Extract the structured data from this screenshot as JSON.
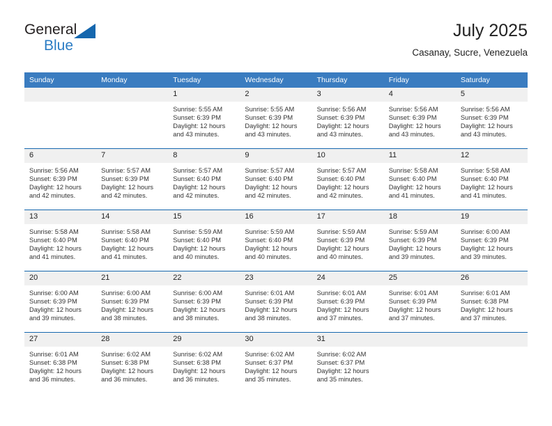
{
  "brand": {
    "name_part1": "General",
    "name_part2": "Blue"
  },
  "header": {
    "title": "July 2025",
    "subtitle": "Casanay, Sucre, Venezuela"
  },
  "colors": {
    "header_blue": "#3a7cc0",
    "rule_blue": "#1567ae",
    "daynum_band": "#f0f0f0",
    "logo_blue": "#2b7cc4"
  },
  "weekdays": [
    "Sunday",
    "Monday",
    "Tuesday",
    "Wednesday",
    "Thursday",
    "Friday",
    "Saturday"
  ],
  "weeks": [
    [
      {
        "day": "",
        "lines": []
      },
      {
        "day": "",
        "lines": []
      },
      {
        "day": "1",
        "lines": [
          "Sunrise: 5:55 AM",
          "Sunset: 6:39 PM",
          "Daylight: 12 hours",
          "and 43 minutes."
        ]
      },
      {
        "day": "2",
        "lines": [
          "Sunrise: 5:55 AM",
          "Sunset: 6:39 PM",
          "Daylight: 12 hours",
          "and 43 minutes."
        ]
      },
      {
        "day": "3",
        "lines": [
          "Sunrise: 5:56 AM",
          "Sunset: 6:39 PM",
          "Daylight: 12 hours",
          "and 43 minutes."
        ]
      },
      {
        "day": "4",
        "lines": [
          "Sunrise: 5:56 AM",
          "Sunset: 6:39 PM",
          "Daylight: 12 hours",
          "and 43 minutes."
        ]
      },
      {
        "day": "5",
        "lines": [
          "Sunrise: 5:56 AM",
          "Sunset: 6:39 PM",
          "Daylight: 12 hours",
          "and 43 minutes."
        ]
      }
    ],
    [
      {
        "day": "6",
        "lines": [
          "Sunrise: 5:56 AM",
          "Sunset: 6:39 PM",
          "Daylight: 12 hours",
          "and 42 minutes."
        ]
      },
      {
        "day": "7",
        "lines": [
          "Sunrise: 5:57 AM",
          "Sunset: 6:39 PM",
          "Daylight: 12 hours",
          "and 42 minutes."
        ]
      },
      {
        "day": "8",
        "lines": [
          "Sunrise: 5:57 AM",
          "Sunset: 6:40 PM",
          "Daylight: 12 hours",
          "and 42 minutes."
        ]
      },
      {
        "day": "9",
        "lines": [
          "Sunrise: 5:57 AM",
          "Sunset: 6:40 PM",
          "Daylight: 12 hours",
          "and 42 minutes."
        ]
      },
      {
        "day": "10",
        "lines": [
          "Sunrise: 5:57 AM",
          "Sunset: 6:40 PM",
          "Daylight: 12 hours",
          "and 42 minutes."
        ]
      },
      {
        "day": "11",
        "lines": [
          "Sunrise: 5:58 AM",
          "Sunset: 6:40 PM",
          "Daylight: 12 hours",
          "and 41 minutes."
        ]
      },
      {
        "day": "12",
        "lines": [
          "Sunrise: 5:58 AM",
          "Sunset: 6:40 PM",
          "Daylight: 12 hours",
          "and 41 minutes."
        ]
      }
    ],
    [
      {
        "day": "13",
        "lines": [
          "Sunrise: 5:58 AM",
          "Sunset: 6:40 PM",
          "Daylight: 12 hours",
          "and 41 minutes."
        ]
      },
      {
        "day": "14",
        "lines": [
          "Sunrise: 5:58 AM",
          "Sunset: 6:40 PM",
          "Daylight: 12 hours",
          "and 41 minutes."
        ]
      },
      {
        "day": "15",
        "lines": [
          "Sunrise: 5:59 AM",
          "Sunset: 6:40 PM",
          "Daylight: 12 hours",
          "and 40 minutes."
        ]
      },
      {
        "day": "16",
        "lines": [
          "Sunrise: 5:59 AM",
          "Sunset: 6:40 PM",
          "Daylight: 12 hours",
          "and 40 minutes."
        ]
      },
      {
        "day": "17",
        "lines": [
          "Sunrise: 5:59 AM",
          "Sunset: 6:39 PM",
          "Daylight: 12 hours",
          "and 40 minutes."
        ]
      },
      {
        "day": "18",
        "lines": [
          "Sunrise: 5:59 AM",
          "Sunset: 6:39 PM",
          "Daylight: 12 hours",
          "and 39 minutes."
        ]
      },
      {
        "day": "19",
        "lines": [
          "Sunrise: 6:00 AM",
          "Sunset: 6:39 PM",
          "Daylight: 12 hours",
          "and 39 minutes."
        ]
      }
    ],
    [
      {
        "day": "20",
        "lines": [
          "Sunrise: 6:00 AM",
          "Sunset: 6:39 PM",
          "Daylight: 12 hours",
          "and 39 minutes."
        ]
      },
      {
        "day": "21",
        "lines": [
          "Sunrise: 6:00 AM",
          "Sunset: 6:39 PM",
          "Daylight: 12 hours",
          "and 38 minutes."
        ]
      },
      {
        "day": "22",
        "lines": [
          "Sunrise: 6:00 AM",
          "Sunset: 6:39 PM",
          "Daylight: 12 hours",
          "and 38 minutes."
        ]
      },
      {
        "day": "23",
        "lines": [
          "Sunrise: 6:01 AM",
          "Sunset: 6:39 PM",
          "Daylight: 12 hours",
          "and 38 minutes."
        ]
      },
      {
        "day": "24",
        "lines": [
          "Sunrise: 6:01 AM",
          "Sunset: 6:39 PM",
          "Daylight: 12 hours",
          "and 37 minutes."
        ]
      },
      {
        "day": "25",
        "lines": [
          "Sunrise: 6:01 AM",
          "Sunset: 6:39 PM",
          "Daylight: 12 hours",
          "and 37 minutes."
        ]
      },
      {
        "day": "26",
        "lines": [
          "Sunrise: 6:01 AM",
          "Sunset: 6:38 PM",
          "Daylight: 12 hours",
          "and 37 minutes."
        ]
      }
    ],
    [
      {
        "day": "27",
        "lines": [
          "Sunrise: 6:01 AM",
          "Sunset: 6:38 PM",
          "Daylight: 12 hours",
          "and 36 minutes."
        ]
      },
      {
        "day": "28",
        "lines": [
          "Sunrise: 6:02 AM",
          "Sunset: 6:38 PM",
          "Daylight: 12 hours",
          "and 36 minutes."
        ]
      },
      {
        "day": "29",
        "lines": [
          "Sunrise: 6:02 AM",
          "Sunset: 6:38 PM",
          "Daylight: 12 hours",
          "and 36 minutes."
        ]
      },
      {
        "day": "30",
        "lines": [
          "Sunrise: 6:02 AM",
          "Sunset: 6:37 PM",
          "Daylight: 12 hours",
          "and 35 minutes."
        ]
      },
      {
        "day": "31",
        "lines": [
          "Sunrise: 6:02 AM",
          "Sunset: 6:37 PM",
          "Daylight: 12 hours",
          "and 35 minutes."
        ]
      },
      {
        "day": "",
        "lines": []
      },
      {
        "day": "",
        "lines": []
      }
    ]
  ]
}
